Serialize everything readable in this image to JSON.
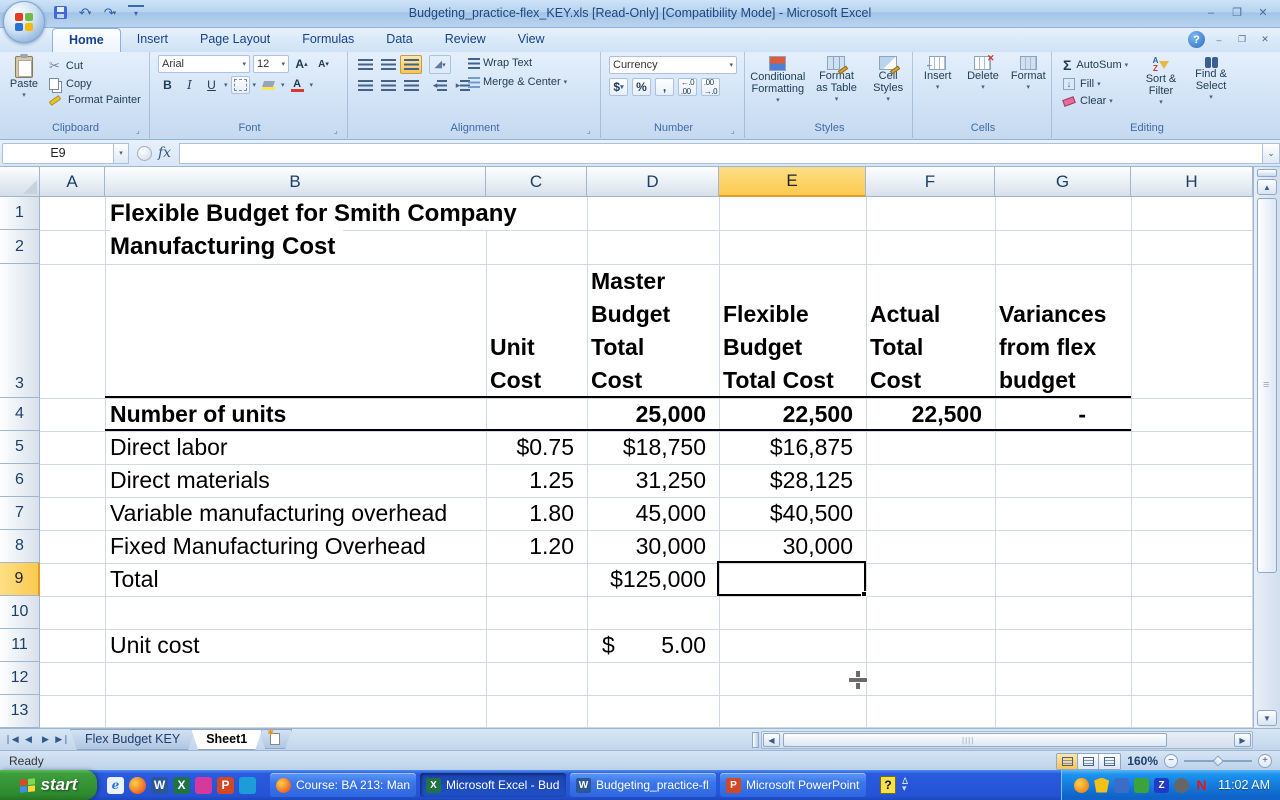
{
  "window": {
    "title": "Budgeting_practice-flex_KEY.xls  [Read-Only]  [Compatibility Mode] - Microsoft Excel",
    "controls": {
      "minimize": "–",
      "restore": "❐",
      "close": "✕"
    }
  },
  "ribbon": {
    "tabs": [
      "Home",
      "Insert",
      "Page Layout",
      "Formulas",
      "Data",
      "Review",
      "View"
    ],
    "active_tab": "Home",
    "clipboard": {
      "title": "Clipboard",
      "paste": "Paste",
      "cut": "Cut",
      "copy": "Copy",
      "format_painter": "Format Painter"
    },
    "font": {
      "title": "Font",
      "family": "Arial",
      "size": "12",
      "bold": "B",
      "italic": "I",
      "underline": "U"
    },
    "alignment": {
      "title": "Alignment",
      "wrap_text": "Wrap Text",
      "merge_center": "Merge & Center"
    },
    "number": {
      "title": "Number",
      "format": "Currency",
      "currency": "$",
      "percent": "%",
      "comma": ","
    },
    "styles": {
      "title": "Styles",
      "conditional": "Conditional\nFormatting",
      "format_table": "Format\nas Table",
      "cell_styles": "Cell\nStyles"
    },
    "cells": {
      "title": "Cells",
      "insert": "Insert",
      "delete": "Delete",
      "format": "Format"
    },
    "editing": {
      "title": "Editing",
      "sigma": "Σ",
      "autosum": "AutoSum",
      "fill": "Fill",
      "clear": "Clear",
      "sort_filter": "Sort &\nFilter",
      "find_select": "Find &\nSelect"
    }
  },
  "formula_bar": {
    "name_box": "E9",
    "fx": "fx",
    "formula": ""
  },
  "grid": {
    "selected_cell": "E9",
    "col_headers": [
      "A",
      "B",
      "C",
      "D",
      "E",
      "F",
      "G",
      "H"
    ],
    "row_headers": [
      "1",
      "2",
      "3",
      "4",
      "5",
      "6",
      "7",
      "8",
      "9",
      "10",
      "11",
      "12",
      "13"
    ],
    "cells": {
      "b1": "Flexible Budget for Smith Company",
      "b2": "Manufacturing Cost",
      "c3": "Unit\nCost",
      "d3": "Master\nBudget\nTotal\nCost",
      "e3": "Flexible\nBudget\nTotal Cost",
      "f3": "Actual\nTotal\nCost",
      "g3": "Variances\nfrom flex\nbudget",
      "b4": "Number of units",
      "d4": "25,000",
      "e4": "22,500",
      "f4": "22,500",
      "g4": "-",
      "b5": "Direct labor",
      "c5": "$0.75",
      "d5": "$18,750",
      "e5": "$16,875",
      "b6": "Direct materials",
      "c6": "1.25",
      "d6": "31,250",
      "e6": "$28,125",
      "b7": "Variable manufacturing overhead",
      "c7": "1.80",
      "d7": "45,000",
      "e7": "$40,500",
      "b8": "Fixed Manufacturing Overhead",
      "c8": "1.20",
      "d8": "30,000",
      "e8": "30,000",
      "b9": "Total",
      "d9": "$125,000",
      "b11": "Unit cost",
      "d11_symbol": "$",
      "d11_value": "5.00"
    }
  },
  "sheet_tabs": {
    "tab1": "Flex Budget KEY",
    "tab2": "Sheet1",
    "active": "Sheet1"
  },
  "status_bar": {
    "mode": "Ready",
    "zoom_level": "160%"
  },
  "taskbar": {
    "start_label": "start",
    "quick_launch_icons": [
      "internet-explorer",
      "firefox",
      "word",
      "excel",
      "messenger",
      "powerpoint",
      "outlook"
    ],
    "buttons": [
      {
        "label": "Course: BA 213: Man...",
        "icon": "firefox"
      },
      {
        "label": "Microsoft Excel - Bud...",
        "icon": "excel",
        "active": true
      },
      {
        "label": "Budgeting_practice-fl...",
        "icon": "word"
      },
      {
        "label": "Microsoft PowerPoint ...",
        "icon": "powerpoint"
      }
    ],
    "clock": "11:02 AM"
  },
  "colors": {
    "selected_header": "#fbca4f",
    "selection_border": "#000000",
    "taskbar_blue": "#2a5ade",
    "start_green": "#3c9e3c",
    "ribbon_blue": "#d2e3f6",
    "gridline": "#d0d7e5",
    "title_text": "#1e477e"
  }
}
